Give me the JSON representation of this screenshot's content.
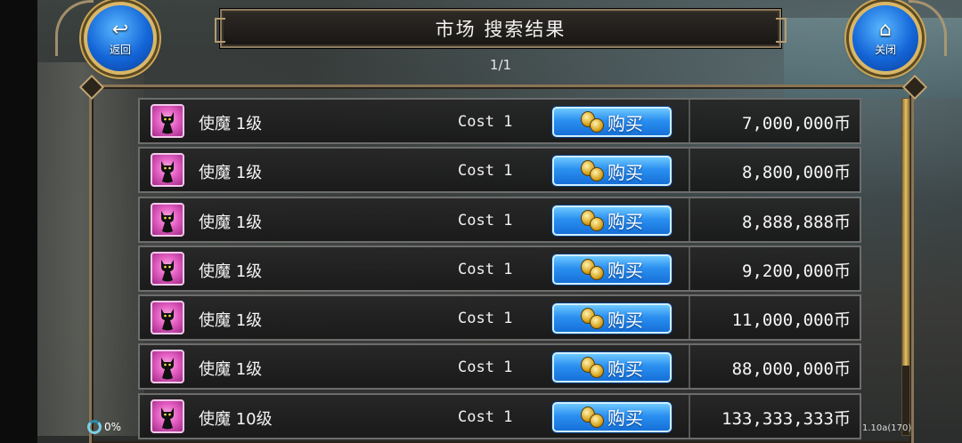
{
  "header": {
    "title": "市场 搜索结果",
    "page": "1/1",
    "back_label": "返回",
    "close_label": "关闭"
  },
  "items": [
    {
      "name": "使魔",
      "level": "1级",
      "cost": "Cost 1",
      "buy_label": "购买",
      "price": "7,000,000币"
    },
    {
      "name": "使魔",
      "level": "1级",
      "cost": "Cost 1",
      "buy_label": "购买",
      "price": "8,800,000币"
    },
    {
      "name": "使魔",
      "level": "1级",
      "cost": "Cost 1",
      "buy_label": "购买",
      "price": "8,888,888币"
    },
    {
      "name": "使魔",
      "level": "1级",
      "cost": "Cost 1",
      "buy_label": "购买",
      "price": "9,200,000币"
    },
    {
      "name": "使魔",
      "level": "1级",
      "cost": "Cost 1",
      "buy_label": "购买",
      "price": "11,000,000币"
    },
    {
      "name": "使魔",
      "level": "1级",
      "cost": "Cost 1",
      "buy_label": "购买",
      "price": "88,000,000币"
    },
    {
      "name": "使魔",
      "level": "10级",
      "cost": "Cost 1",
      "buy_label": "购买",
      "price": "133,333,333币"
    }
  ],
  "status": {
    "loading_percent": "0%",
    "version": "1.10a(170)"
  },
  "colors": {
    "button_blue": "#1670d8",
    "frame_gold": "#c9a65a",
    "icon_pink": "#e660c4"
  },
  "icons": {
    "back": "return-arrow-icon",
    "close": "home-icon",
    "item": "black-cat-icon",
    "buy": "coin-icon"
  }
}
